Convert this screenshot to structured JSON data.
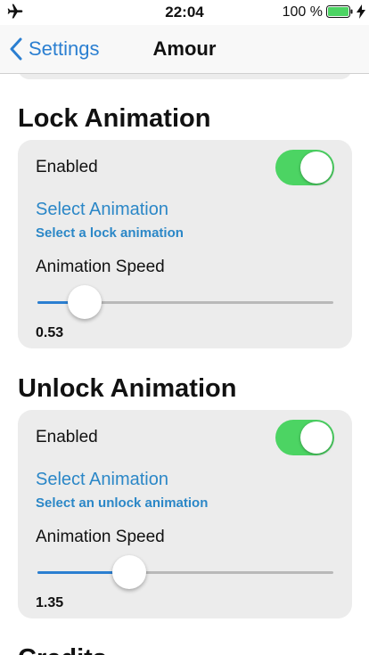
{
  "status_bar": {
    "time": "22:04",
    "battery_percent": "100 %",
    "battery_level": 1.0,
    "icons": [
      "airplane-icon",
      "battery-icon",
      "charging-bolt-icon"
    ],
    "battery_color": "#4cd463"
  },
  "nav": {
    "back_label": "Settings",
    "title": "Amour"
  },
  "sections": [
    {
      "title": "Lock Animation",
      "enabled_label": "Enabled",
      "enabled": true,
      "select_label": "Select Animation",
      "select_subtitle": "Select a lock animation",
      "speed_label": "Animation Speed",
      "speed_value": "0.53",
      "speed_fraction": 0.16
    },
    {
      "title": "Unlock Animation",
      "enabled_label": "Enabled",
      "enabled": true,
      "select_label": "Select Animation",
      "select_subtitle": "Select an unlock animation",
      "speed_label": "Animation Speed",
      "speed_value": "1.35",
      "speed_fraction": 0.31
    },
    {
      "title": "Credits"
    }
  ],
  "colors": {
    "accent": "#2b7fd1",
    "link": "#2b87c7",
    "toggle_on": "#4cd463",
    "card_bg": "#ececec"
  }
}
